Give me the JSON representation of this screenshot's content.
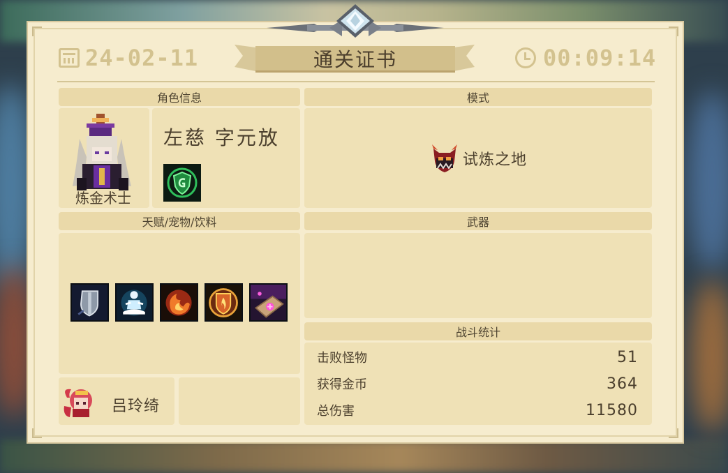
{
  "header": {
    "date": "24-02-11",
    "time": "00:09:14",
    "title": "通关证书",
    "date_icon": "calendar-icon",
    "time_icon": "clock-icon"
  },
  "sections": {
    "character_info": "角色信息",
    "mode": "模式",
    "talents": "天赋/宠物/饮料",
    "weapons": "武器",
    "battle_stats": "战斗统计"
  },
  "character": {
    "class_name": "炼金术士",
    "skin_name": "左慈 字元放",
    "portrait_icon": "alchemist-portrait-icon",
    "skill_icon": "green-shield-skill-icon"
  },
  "mode": {
    "label": "试炼之地",
    "icon": "demon-mask-icon"
  },
  "talents": [
    {
      "icon": "shield-armor-talent-icon"
    },
    {
      "icon": "meditation-talent-icon"
    },
    {
      "icon": "fire-swirl-talent-icon"
    },
    {
      "icon": "flame-shield-talent-icon"
    },
    {
      "icon": "magic-scroll-talent-icon"
    }
  ],
  "pet": {
    "name": "吕玲绮",
    "icon": "pet-portrait-icon"
  },
  "stats": [
    {
      "label": "击败怪物",
      "value": "51"
    },
    {
      "label": "获得金币",
      "value": "364"
    },
    {
      "label": "总伤害",
      "value": "11580"
    }
  ],
  "colors": {
    "card_bg": "#f6ecce",
    "section_header": "#ead9a9",
    "panel_bg": "#efe1b6",
    "text": "#4b3f2d",
    "accent_gold": "#d3c28f"
  }
}
